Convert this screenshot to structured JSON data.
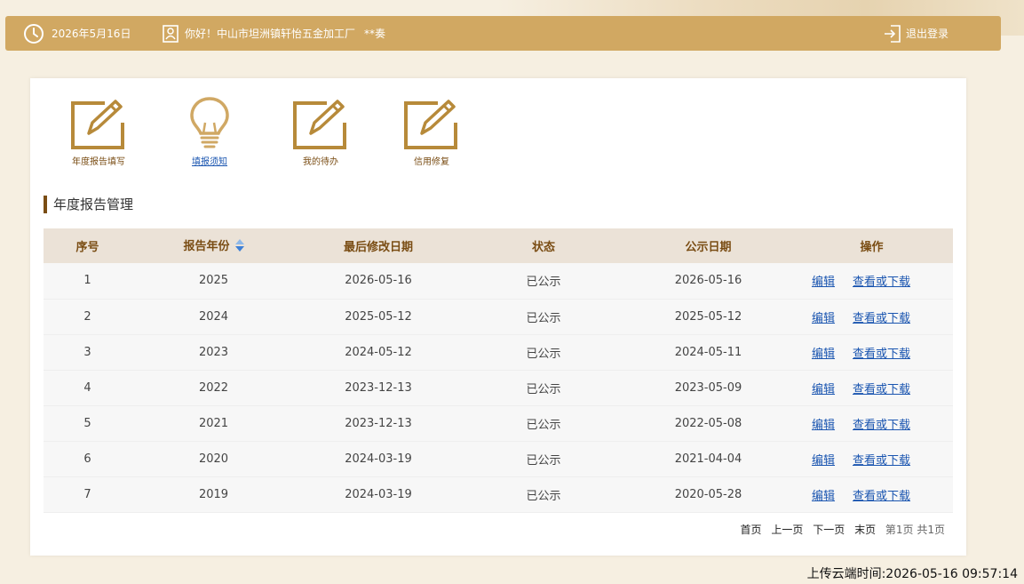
{
  "header": {
    "date": "2026年5月16日",
    "greeting": "你好！中山市坦洲镇轩怡五金加工厂",
    "user": "**奏",
    "logout_label": "退出登录"
  },
  "quick_links": [
    {
      "label": "年度报告填写",
      "icon": "edit-icon"
    },
    {
      "label": "填报须知",
      "icon": "lightbulb-icon"
    },
    {
      "label": "我的待办",
      "icon": "edit-icon"
    },
    {
      "label": "信用修复",
      "icon": "edit-icon"
    }
  ],
  "section_title": "年度报告管理",
  "table": {
    "headers": [
      "序号",
      "报告年份",
      "最后修改日期",
      "状态",
      "公示日期",
      "操作"
    ],
    "edit_label": "编辑",
    "view_label": "查看或下载",
    "rows": [
      [
        "1",
        "2025",
        "2026-05-16",
        "已公示",
        "2026-05-16"
      ],
      [
        "2",
        "2024",
        "2025-05-12",
        "已公示",
        "2025-05-12"
      ],
      [
        "3",
        "2023",
        "2024-05-12",
        "已公示",
        "2024-05-11"
      ],
      [
        "4",
        "2022",
        "2023-12-13",
        "已公示",
        "2023-05-09"
      ],
      [
        "5",
        "2021",
        "2023-12-13",
        "已公示",
        "2022-05-08"
      ],
      [
        "6",
        "2020",
        "2024-03-19",
        "已公示",
        "2021-04-04"
      ],
      [
        "7",
        "2019",
        "2024-03-19",
        "已公示",
        "2020-05-28"
      ]
    ]
  },
  "pager": {
    "first": "首页",
    "prev": "上一页",
    "next": "下一页",
    "last": "末页",
    "info": "第1页 共1页"
  },
  "upload_time": "上传云端时间:2026-05-16 09:57:14",
  "colors": {
    "header_bg": "#d1a862",
    "accent_brown": "#7a4d14",
    "icon_gold": "#b78a3a",
    "link_blue": "#1a55b0"
  }
}
